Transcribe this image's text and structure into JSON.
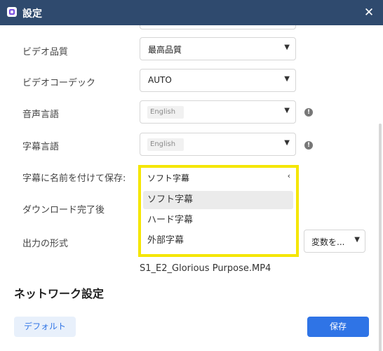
{
  "window": {
    "title": "設定",
    "close_label": "✕"
  },
  "settings": {
    "video_quality": {
      "label": "ビデオ品質",
      "value": "最高品質"
    },
    "video_codec": {
      "label": "ビデオコーデック",
      "value": "AUTO"
    },
    "audio_language": {
      "label": "音声言語",
      "value": "English"
    },
    "subtitle_language": {
      "label": "字幕言語",
      "value": "English"
    },
    "save_subtitle_as": {
      "label": "字幕に名前を付けて保存:",
      "value": "ソフト字幕",
      "options": [
        "ソフト字幕",
        "ハード字幕",
        "外部字幕"
      ],
      "highlight_color": "#f5e600"
    },
    "after_download": {
      "label": "ダウンロード完了後"
    },
    "output_format": {
      "label": "出力の形式",
      "variable_select": "変数を..."
    },
    "filename_preview": "S1_E2_Glorious Purpose.MP4"
  },
  "network_section": {
    "title": "ネットワーク設定"
  },
  "footer": {
    "default_label": "デフォルト",
    "save_label": "保存"
  },
  "colors": {
    "titlebar": "#2f4a6e",
    "primary": "#2f74e6",
    "highlight": "#f5e600"
  },
  "icons": {
    "app": "app-icon",
    "close": "close-icon",
    "chevron_down": "chevron-down-icon",
    "chevron_left": "chevron-left-icon",
    "info": "info-icon"
  }
}
